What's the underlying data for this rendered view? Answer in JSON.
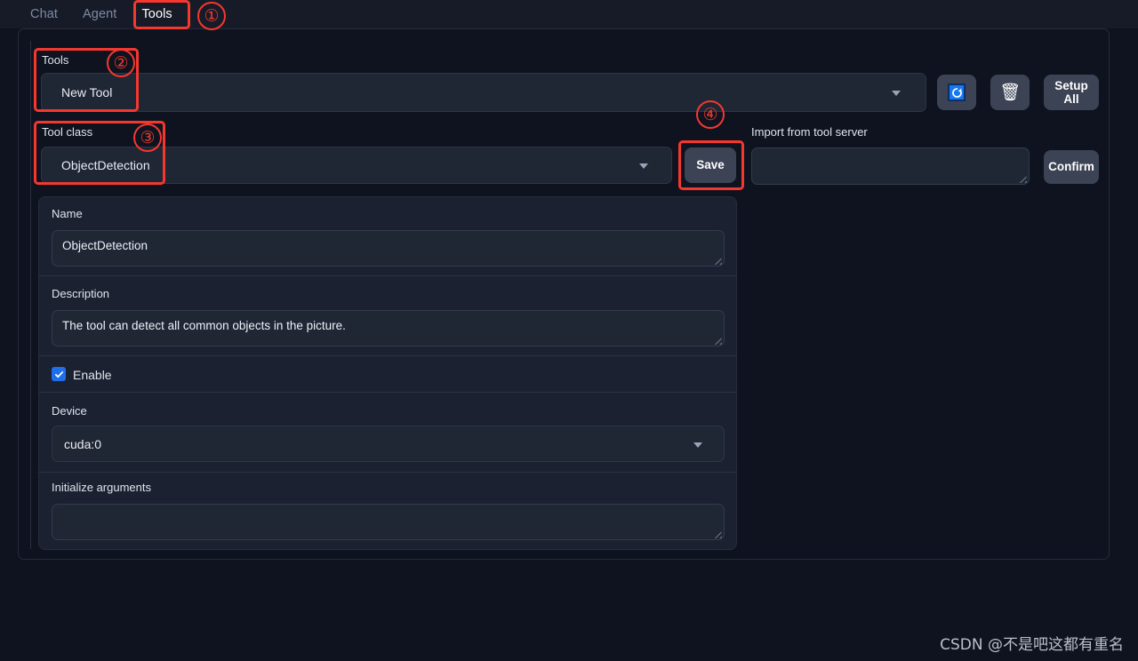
{
  "tabs": [
    {
      "label": "Chat",
      "active": false
    },
    {
      "label": "Agent",
      "active": false
    },
    {
      "label": "Tools",
      "active": true
    }
  ],
  "tools_section": {
    "label": "Tools",
    "selected_tool": "New Tool"
  },
  "tool_class_section": {
    "label": "Tool class",
    "selected_class": "ObjectDetection"
  },
  "toolbar": {
    "refresh_icon": "refresh-icon",
    "delete_icon": "trash-icon",
    "setup_all_label": "Setup\nAll",
    "setup_all_line1": "Setup",
    "setup_all_line2": "All",
    "save_label": "Save",
    "confirm_label": "Confirm"
  },
  "import_section": {
    "label": "Import from tool server",
    "value": "",
    "placeholder": ""
  },
  "form": {
    "name_label": "Name",
    "name_value": "ObjectDetection",
    "description_label": "Description",
    "description_value": "The tool can detect all common objects in the picture.",
    "enable_label": "Enable",
    "enable_checked": true,
    "device_label": "Device",
    "device_value": "cuda:0",
    "init_args_label": "Initialize arguments",
    "init_args_value": ""
  },
  "annotations": [
    {
      "number": "①"
    },
    {
      "number": "②"
    },
    {
      "number": "③"
    },
    {
      "number": "④"
    }
  ],
  "watermark": "CSDN @不是吧这都有重名",
  "colors": {
    "accent_blue": "#1f6feb",
    "annotation_red": "#f4382e",
    "background": "#0f131f",
    "panel": "#1b2130"
  }
}
